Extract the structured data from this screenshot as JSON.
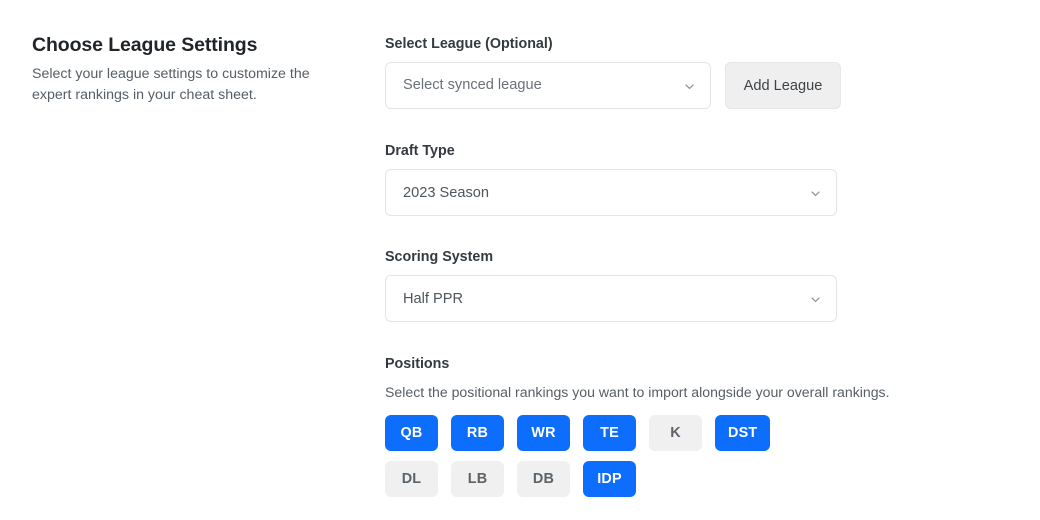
{
  "theme": {
    "accent": "#0d6efd",
    "pill_unselected_bg": "#f0f0f0",
    "pill_unselected_text": "#5c6369",
    "button_secondary_bg": "#efefef",
    "page_bg": "#ffffff",
    "border": "#e2e4e8",
    "heading_text": "#212529",
    "body_text": "#565e66"
  },
  "panel": {
    "title": "Choose League Settings",
    "description": "Select your league settings to customize the expert rankings in your cheat sheet."
  },
  "form": {
    "league": {
      "label": "Select League (Optional)",
      "placeholder": "Select synced league",
      "value": "",
      "display": "Select synced league",
      "add_button": "Add League",
      "chevron_icon": "chevron-down-icon"
    },
    "draft_type": {
      "label": "Draft Type",
      "value": "2023 Season",
      "chevron_icon": "chevron-down-icon"
    },
    "scoring_system": {
      "label": "Scoring System",
      "value": "Half PPR",
      "chevron_icon": "chevron-down-icon"
    },
    "positions": {
      "label": "Positions",
      "description": "Select the positional rankings you want to import alongside your overall rankings.",
      "rows": [
        [
          {
            "label": "QB",
            "selected": true
          },
          {
            "label": "RB",
            "selected": true
          },
          {
            "label": "WR",
            "selected": true
          },
          {
            "label": "TE",
            "selected": true
          },
          {
            "label": "K",
            "selected": false
          },
          {
            "label": "DST",
            "selected": true
          }
        ],
        [
          {
            "label": "DL",
            "selected": false
          },
          {
            "label": "LB",
            "selected": false
          },
          {
            "label": "DB",
            "selected": false
          },
          {
            "label": "IDP",
            "selected": true
          }
        ]
      ]
    }
  }
}
